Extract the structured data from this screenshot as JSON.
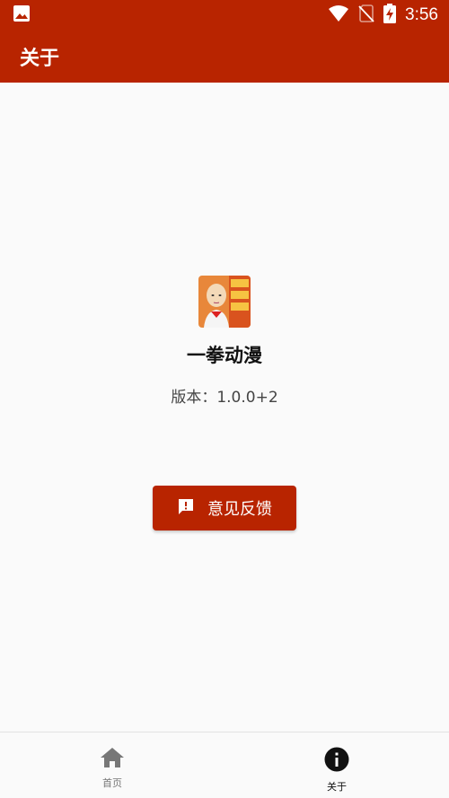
{
  "status_bar": {
    "time": "3:56",
    "icons": [
      "image-icon",
      "wifi-icon",
      "no-sim-icon",
      "battery-charging-icon"
    ]
  },
  "app_bar": {
    "title": "关于"
  },
  "about": {
    "app_name": "一拳动漫",
    "version_label": "版本：",
    "version_value": "1.0.0+2",
    "feedback_label": "意见反馈",
    "feedback_icon": "feedback-icon"
  },
  "bottom_nav": {
    "items": [
      {
        "label": "首页",
        "icon": "home-icon",
        "active": false
      },
      {
        "label": "关于",
        "icon": "info-icon",
        "active": true
      }
    ]
  },
  "colors": {
    "primary": "#b82400",
    "background": "#fafafa",
    "nav_inactive": "#777777",
    "nav_active": "#111111"
  }
}
